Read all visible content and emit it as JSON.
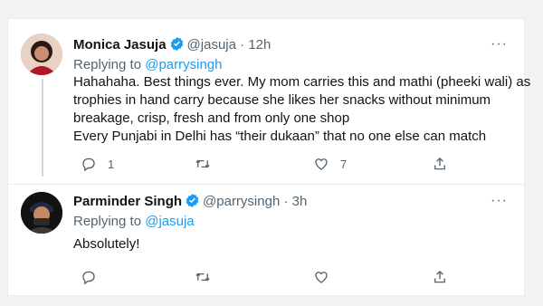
{
  "colors": {
    "link": "#1d9bf0",
    "muted": "#536471",
    "text": "#0f1419",
    "verified": "#1d9bf0"
  },
  "tweets": [
    {
      "name": "Monica Jasuja",
      "handle": "@jasuja",
      "sep": "·",
      "time": "12h",
      "replying_prefix": "Replying to",
      "replying_to": "@parrysingh",
      "lines": [
        "Hahahaha. Best things ever. My mom carries this and mathi (pheeki wali) as",
        "trophies in hand carry because she likes her snacks without minimum",
        "breakage, crisp, fresh and from only one shop",
        "Every Punjabi in Delhi has “their dukaan” that no one else can match"
      ],
      "reply_count": "1",
      "retweet_count": "",
      "like_count": "7"
    },
    {
      "name": "Parminder Singh",
      "handle": "@parrysingh",
      "sep": "·",
      "time": "3h",
      "replying_prefix": "Replying to",
      "replying_to": "@jasuja",
      "lines": [
        "Absolutely!"
      ],
      "reply_count": "",
      "retweet_count": "",
      "like_count": ""
    }
  ],
  "more_label": "···"
}
